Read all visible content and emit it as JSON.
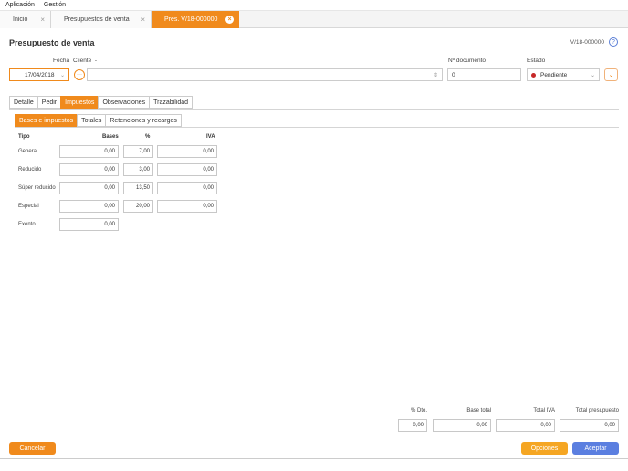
{
  "menu": [
    "Aplicación",
    "Gestión"
  ],
  "tabs": [
    {
      "label": "Inicio"
    },
    {
      "label": "Presupuestos de venta"
    },
    {
      "label": "Pres. V/18-000000"
    }
  ],
  "header": {
    "title": "Presupuesto de venta",
    "doc_number": "V/18-000000"
  },
  "form": {
    "fecha_label": "Fecha",
    "fecha_value": "17/04/2018",
    "cliente_label": "Cliente",
    "cliente_value": "",
    "ndoc_label": "Nº documento",
    "ndoc_value": "0",
    "estado_label": "Estado",
    "estado_value": "Pendiente"
  },
  "main_tabs": [
    "Detalle",
    "Pedir",
    "Impuestos",
    "Observaciones",
    "Trazabilidad"
  ],
  "sub_tabs": [
    "Bases e impuestos",
    "Totales",
    "Retenciones y recargos"
  ],
  "table": {
    "headers": {
      "tipo": "Tipo",
      "bases": "Bases",
      "pct": "%",
      "iva": "IVA"
    },
    "rows": [
      {
        "tipo": "General",
        "bases": "0,00",
        "pct": "7,00",
        "iva": "0,00"
      },
      {
        "tipo": "Reducido",
        "bases": "0,00",
        "pct": "3,00",
        "iva": "0,00"
      },
      {
        "tipo": "Súper reducido",
        "bases": "0,00",
        "pct": "13,50",
        "iva": "0,00"
      },
      {
        "tipo": "Especial",
        "bases": "0,00",
        "pct": "20,00",
        "iva": "0,00"
      },
      {
        "tipo": "Exento",
        "bases": "0,00"
      }
    ]
  },
  "summary": {
    "dto_label": "% Dto.",
    "dto_value": "0,00",
    "base_label": "Base total",
    "base_value": "0,00",
    "iva_label": "Total IVA",
    "iva_value": "0,00",
    "total_label": "Total presupuesto",
    "total_value": "0,00"
  },
  "buttons": {
    "cancel": "Cancelar",
    "options": "Opciones",
    "accept": "Aceptar"
  },
  "colors": {
    "accent": "#f08a1c",
    "options": "#f5a623",
    "accept": "#5b7fe0",
    "status_dot": "#c62828"
  }
}
